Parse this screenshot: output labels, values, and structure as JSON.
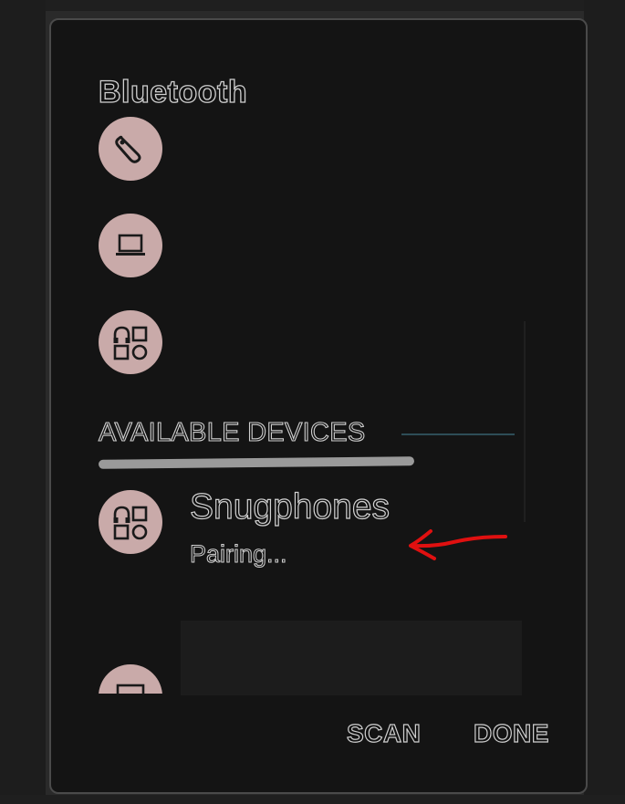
{
  "dialog": {
    "title": "Bluetooth"
  },
  "paired_devices": [
    {
      "icon": "headset-icon"
    },
    {
      "icon": "laptop-icon"
    },
    {
      "icon": "device-category-icon"
    }
  ],
  "available_section": {
    "label": "AVAILABLE DEVICES"
  },
  "available_devices": [
    {
      "name": "Snugphones",
      "status": "Pairing...",
      "icon": "device-category-icon"
    },
    {
      "icon": "computer-icon"
    }
  ],
  "actions": {
    "scan_label": "SCAN",
    "done_label": "DONE"
  },
  "colors": {
    "icon_circle": "#c9aaa9",
    "dialog_bg": "#141414",
    "annotation_arrow": "#e01010",
    "divider": "#2e4d57"
  }
}
